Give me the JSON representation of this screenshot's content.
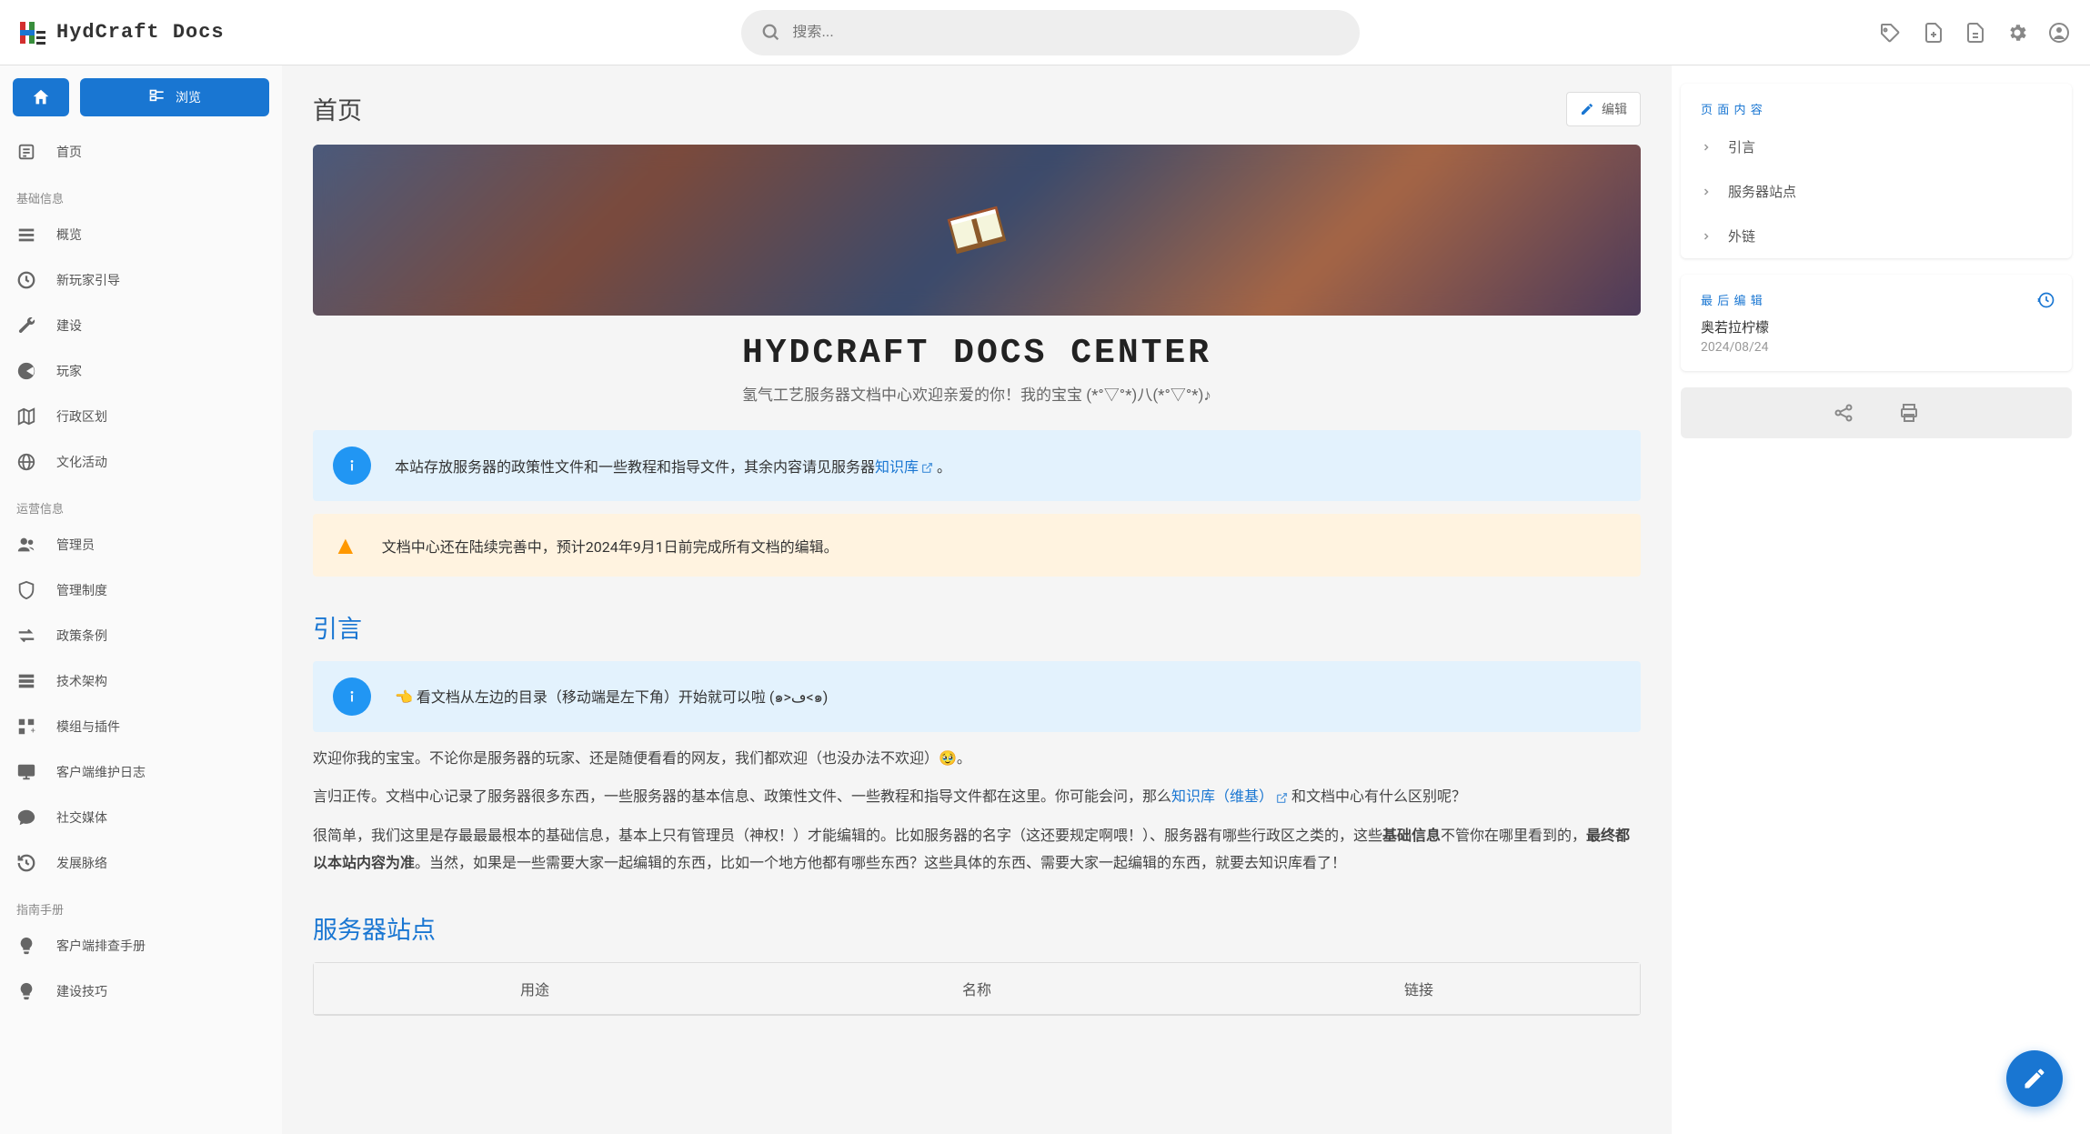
{
  "site": {
    "title": "HydCraft Docs"
  },
  "search": {
    "placeholder": "搜索..."
  },
  "nav_top": {
    "browse": "浏览"
  },
  "sidebar": {
    "home": "首页",
    "sections": [
      {
        "title": "基础信息",
        "items": [
          {
            "icon": "list",
            "label": "概览"
          },
          {
            "icon": "clock",
            "label": "新玩家引导"
          },
          {
            "icon": "wrench",
            "label": "建设"
          },
          {
            "icon": "pacman",
            "label": "玩家"
          },
          {
            "icon": "map",
            "label": "行政区划"
          },
          {
            "icon": "globe",
            "label": "文化活动"
          }
        ]
      },
      {
        "title": "运营信息",
        "items": [
          {
            "icon": "people",
            "label": "管理员"
          },
          {
            "icon": "shield",
            "label": "管理制度"
          },
          {
            "icon": "arrows",
            "label": "政策条例"
          },
          {
            "icon": "server",
            "label": "技术架构"
          },
          {
            "icon": "blocks",
            "label": "模组与插件"
          },
          {
            "icon": "monitor",
            "label": "客户端维护日志"
          },
          {
            "icon": "chat",
            "label": "社交媒体"
          },
          {
            "icon": "history",
            "label": "发展脉络"
          }
        ]
      },
      {
        "title": "指南手册",
        "items": [
          {
            "icon": "bulb",
            "label": "客户端排查手册"
          },
          {
            "icon": "bulb",
            "label": "建设技巧"
          }
        ]
      }
    ]
  },
  "page": {
    "title": "首页",
    "edit_button": "编辑",
    "banner_h1": "HYDCRAFT DOCS CENTER",
    "banner_sub": "氢气工艺服务器文档中心欢迎亲爱的你！我的宝宝 (*°▽°*)八(*°▽°*)♪",
    "alert_info_prefix": "本站存放服务器的政策性文件和一些教程和指导文件，其余内容请见服务器",
    "alert_info_link": "知识库",
    "alert_info_suffix": " 。",
    "alert_warn": "文档中心还在陆续完善中，预计2024年9月1日前完成所有文档的编辑。",
    "h2_intro": "引言",
    "alert_tip": "👈 看文档从左边的目录（移动端是左下角）开始就可以啦 (๑>ڡ<๑)",
    "para1": "欢迎你我的宝宝。不论你是服务器的玩家、还是随便看看的网友，我们都欢迎（也没办法不欢迎）🥹。",
    "para2_a": "言归正传。文档中心记录了服务器很多东西，一些服务器的基本信息、政策性文件、一些教程和指导文件都在这里。你可能会问，那么",
    "para2_link": "知识库（维基）",
    "para2_b": " 和文档中心有什么区别呢？",
    "para3_a": "很简单，我们这里是存最最最根本的基础信息，基本上只有管理员（神权！）才能编辑的。比如服务器的名字（这还要规定啊喂！）、服务器有哪些行政区之类的，这些",
    "para3_bold1": "基础信息",
    "para3_b": "不管你在哪里看到的，",
    "para3_bold2": "最终都以本站内容为准",
    "para3_c": "。当然，如果是一些需要大家一起编辑的东西，比如一个地方他都有哪些东西？这些具体的东西、需要大家一起编辑的东西，就要去知识库看了！",
    "h2_sites": "服务器站点",
    "table_headers": [
      "用途",
      "名称",
      "链接"
    ]
  },
  "toc": {
    "title": "页 面 内 容",
    "items": [
      "引言",
      "服务器站点",
      "外链"
    ]
  },
  "lastedit": {
    "title": "最 后 编 辑",
    "name": "奥若拉柠檬",
    "date": "2024/08/24"
  }
}
